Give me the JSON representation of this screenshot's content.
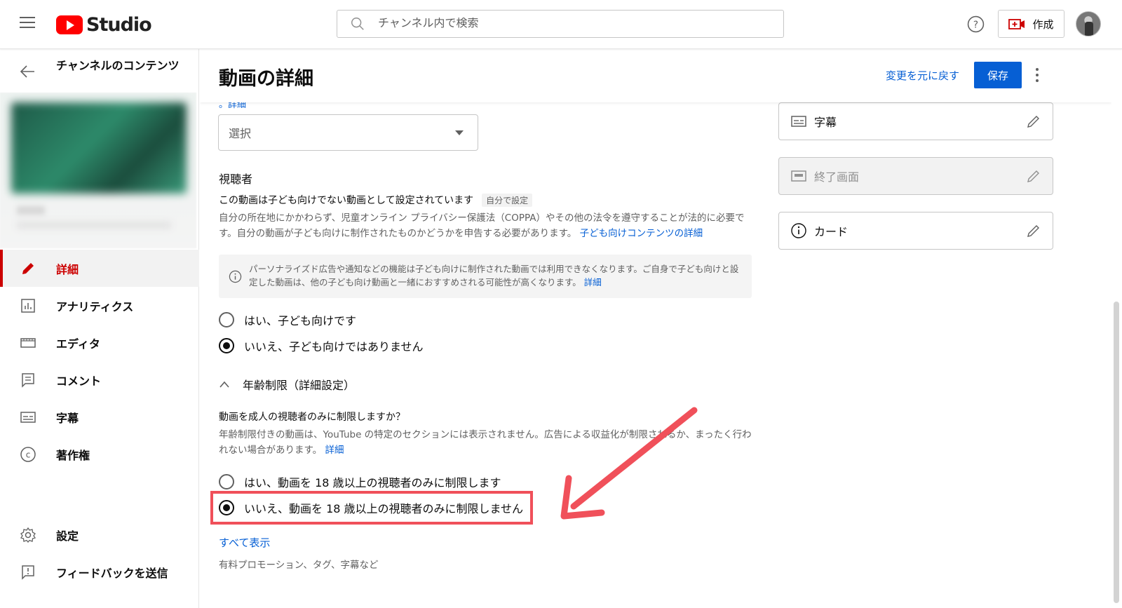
{
  "topbar": {
    "logo_text": "Studio",
    "search_placeholder": "チャンネル内で検索",
    "create_label": "作成"
  },
  "sidebar": {
    "back_title": "チャンネルのコンテンツ",
    "items": [
      {
        "label": "詳細",
        "icon": "pencil-icon",
        "active": true
      },
      {
        "label": "アナリティクス",
        "icon": "analytics-icon"
      },
      {
        "label": "エディタ",
        "icon": "editor-icon"
      },
      {
        "label": "コメント",
        "icon": "comment-icon"
      },
      {
        "label": "字幕",
        "icon": "subtitles-icon"
      },
      {
        "label": "著作権",
        "icon": "copyright-icon"
      }
    ],
    "bottom_items": [
      {
        "label": "設定",
        "icon": "gear-icon"
      },
      {
        "label": "フィードバックを送信",
        "icon": "feedback-icon"
      }
    ]
  },
  "header": {
    "title": "動画の詳細",
    "undo_label": "変更を元に戻す",
    "save_label": "保存"
  },
  "playlist": {
    "partial_link": "。詳細",
    "select_value": "選択"
  },
  "audience": {
    "heading": "視聴者",
    "status": "この動画は子ども向けでない動画として設定されています",
    "status_badge": "自分で設定",
    "description": "自分の所在地にかかわらず、児童オンライン プライバシー保護法（COPPA）やその他の法令を遵守することが法的に必要です。自分の動画が子ども向けに制作されたものかどうかを申告する必要があります。",
    "description_link": "子ども向けコンテンツの詳細",
    "info": "パーソナライズド広告や通知などの機能は子ども向けに制作された動画では利用できなくなります。ご自身で子ども向けと設定した動画は、他の子ども向け動画と一緒におすすめされる可能性が高くなります。",
    "info_link": "詳細",
    "option_yes": "はい、子ども向けです",
    "option_no": "いいえ、子ども向けではありません"
  },
  "age_restriction": {
    "toggle_label": "年齢制限（詳細設定）",
    "question": "動画を成人の視聴者のみに制限しますか？",
    "description": "年齢制限付きの動画は、YouTube の特定のセクションには表示されません。広告による収益化が制限されるか、まったく行われない場合があります。",
    "description_link": "詳細",
    "option_yes": "はい、動画を 18 歳以上の視聴者のみに制限します",
    "option_no": "いいえ、動画を 18 歳以上の視聴者のみに制限しません"
  },
  "footer": {
    "show_all": "すべて表示",
    "show_all_sub": "有料プロモーション、タグ、字幕など"
  },
  "side_cards": [
    {
      "label": "字幕",
      "icon": "subtitles-icon",
      "disabled": false
    },
    {
      "label": "終了画面",
      "icon": "end-screen-icon",
      "disabled": true
    },
    {
      "label": "カード",
      "icon": "info-icon",
      "disabled": false
    }
  ],
  "colors": {
    "accent": "#065fd4",
    "brand_red": "#ff0000",
    "active_red": "#cc0000",
    "annotation": "#f0505a"
  }
}
